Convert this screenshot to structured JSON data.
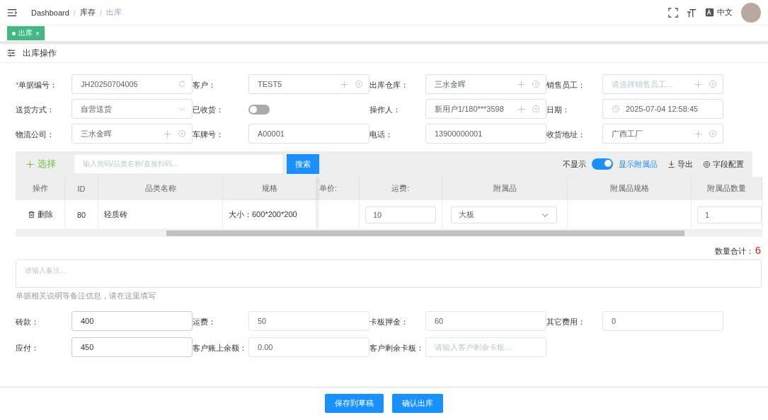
{
  "header": {
    "breadcrumb": [
      {
        "label": "Dashboard",
        "current": false
      },
      {
        "label": "库存",
        "current": false
      },
      {
        "label": "出库",
        "current": true
      }
    ],
    "separator": "/",
    "language": "中文"
  },
  "tabs": [
    {
      "label": "出库",
      "selected": true,
      "close": "×"
    }
  ],
  "section_title": "出库操作",
  "required_mark": "*",
  "form": [
    {
      "label": "单据编号：",
      "required": true,
      "kind": "refresh",
      "value": "JH20250704005"
    },
    {
      "label": "客户：",
      "required": false,
      "kind": "picker",
      "value": "TEST5"
    },
    {
      "label": "出库仓库：",
      "required": false,
      "kind": "picker",
      "value": "三水金晖"
    },
    {
      "label": "销售员工：",
      "required": false,
      "kind": "picker",
      "placeholder": "请选择销售员工..."
    },
    {
      "label": "送货方式：",
      "required": false,
      "kind": "select",
      "value": "自营送货"
    },
    {
      "label": "已收货：",
      "required": false,
      "kind": "switch",
      "on": false
    },
    {
      "label": "操作人：",
      "required": false,
      "kind": "picker",
      "value": "新用户1/180***3598"
    },
    {
      "label": "日期：",
      "required": false,
      "kind": "date",
      "value": "2025-07-04 12:58:45"
    },
    {
      "label": "物流公司：",
      "required": false,
      "kind": "picker",
      "value": "三水金晖"
    },
    {
      "label": "车牌号：",
      "required": false,
      "kind": "text",
      "value": "A00001"
    },
    {
      "label": "电话：",
      "required": false,
      "kind": "text",
      "value": "13900000001"
    },
    {
      "label": "收货地址：",
      "required": false,
      "kind": "picker",
      "value": "广西工厂"
    }
  ],
  "items_toolbar": {
    "select_button": "选择",
    "search_placeholder": "输入简码/品类名称/直接扫码...",
    "search_button": "搜索",
    "toggle_off_label": "不显示",
    "toggle_on": true,
    "toggle_on_label": "显示附属品",
    "export": "导出",
    "field_config": "字段配置"
  },
  "table": {
    "columns": [
      "操作",
      "ID",
      "品类名称",
      "规格",
      "单价:",
      "运费:",
      "附属品",
      "附属品规格",
      "附属品数量"
    ],
    "rows": [
      {
        "delete": "删除",
        "id": "80",
        "name": "轻质砖",
        "spec": "大小：600*200*200",
        "freight": "10",
        "accessory": "大板",
        "accessory_qty": "1"
      }
    ]
  },
  "total": {
    "label": "数量合计：",
    "value": "6"
  },
  "remark": {
    "placeholder": "请输入备注...",
    "hint": "单据相关说明等备注信息，请在这里填写"
  },
  "fees": [
    {
      "label": "砖款：",
      "value": "400",
      "disabled": false
    },
    {
      "label": "运费：",
      "value": "50",
      "disabled": true
    },
    {
      "label": "卡板押金：",
      "value": "60",
      "disabled": true
    },
    {
      "label": "其它费用：",
      "value": "0",
      "disabled": true
    },
    {
      "label": "应付：",
      "value": "450",
      "disabled": false
    },
    {
      "label": "客户账上余额：",
      "value": "0.00",
      "disabled": true
    },
    {
      "label": "客户剩余卡板：",
      "placeholder": "请输入客户剩余卡板...",
      "disabled": true
    }
  ],
  "buttons": [
    "保存到草稿",
    "确认出库"
  ]
}
